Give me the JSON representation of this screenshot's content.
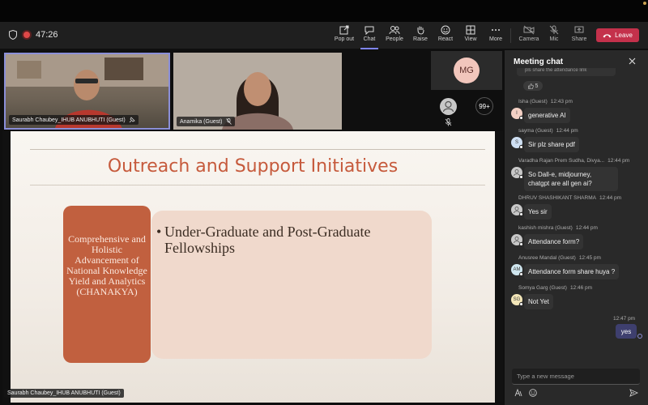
{
  "toolbar": {
    "timer": "47:26",
    "buttons": [
      {
        "key": "popout",
        "label": "Pop out"
      },
      {
        "key": "chat",
        "label": "Chat"
      },
      {
        "key": "people",
        "label": "People"
      },
      {
        "key": "raise",
        "label": "Raise"
      },
      {
        "key": "react",
        "label": "React"
      },
      {
        "key": "view",
        "label": "View"
      },
      {
        "key": "more",
        "label": "More"
      },
      {
        "key": "camera",
        "label": "Camera"
      },
      {
        "key": "mic",
        "label": "Mic"
      },
      {
        "key": "share",
        "label": "Share"
      }
    ],
    "leave_label": "Leave",
    "leave_color": "#c4314b",
    "accent_color": "#7f85f5"
  },
  "participants": {
    "tile1_name": "Saurabh Chaubey_IHUB ANUBHUTI (Guest)",
    "tile2_name": "Anamika (Guest)",
    "mg_initials": "MG",
    "overflow_count": "99+"
  },
  "slide": {
    "title": "Outreach and Support Initiatives",
    "box_text": "Comprehensive and Holistic Advancement of National Knowledge Yield and Analytics (CHANAKYA)",
    "bullet_mark": "•",
    "bullet_text": "Under-Graduate and Post-Graduate Fellowships",
    "presenter_tag": "Saurabh Chaubey_IHUB ANUBHUTI (Guest)"
  },
  "chat": {
    "title": "Meeting chat",
    "first_bubble_partial": "pls share the attendance link",
    "reaction_count": "5",
    "messages": [
      {
        "sender": "Isha (Guest)",
        "time": "12:43 pm",
        "text": "generative AI",
        "initials": "I",
        "avatar_color": "#f3d0c4"
      },
      {
        "sender": "sayma (Guest)",
        "time": "12:44 pm",
        "text": "Sir plz share pdf",
        "initials": "S",
        "avatar_color": "#cfe0f3"
      },
      {
        "sender": "Varadha Rajan Prem Sudha, Divya...",
        "time": "12:44 pm",
        "text": "So Dall-e, midjourney, chatgpt are all gen ai?",
        "initials": "",
        "avatar_color": "#c8c8c8"
      },
      {
        "sender": "DHRUV SHASHIKANT SHARMA",
        "time": "12:44 pm",
        "text": "Yes sir",
        "initials": "",
        "avatar_color": "#c8c8c8"
      },
      {
        "sender": "kashish mishra (Guest)",
        "time": "12:44 pm",
        "text": "Attendance form?",
        "initials": "",
        "avatar_color": "#c8c8c8"
      },
      {
        "sender": "Anusree Mandal (Guest)",
        "time": "12:45 pm",
        "text": "Attendance form share huya ?",
        "initials": "AM",
        "avatar_color": "#cfe6ef"
      },
      {
        "sender": "Somya Garg (Guest)",
        "time": "12:46 pm",
        "text": "Not Yet",
        "initials": "SG",
        "avatar_color": "#f3e6b8"
      }
    ],
    "own_time": "12:47 pm",
    "own_text": "yes",
    "compose_placeholder": "Type a new message"
  }
}
